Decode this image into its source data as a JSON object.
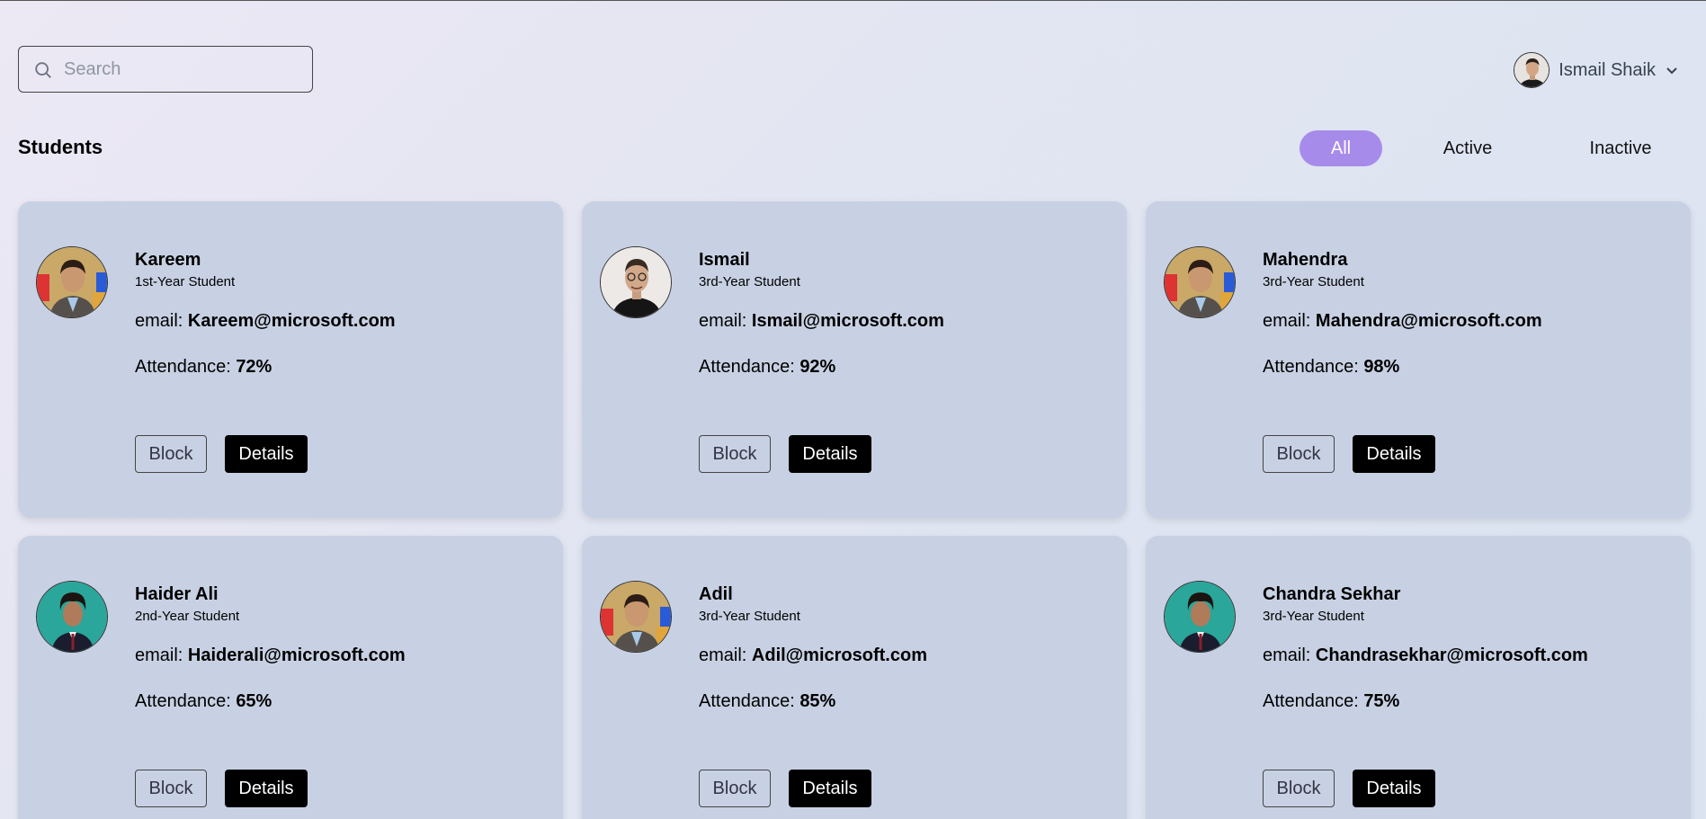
{
  "search": {
    "placeholder": "Search",
    "icon": "search-icon"
  },
  "user": {
    "name": "Ismail Shaik",
    "avatar_icon": "user-avatar",
    "menu_icon": "chevron-down-icon"
  },
  "page": {
    "title": "Students"
  },
  "filters": [
    {
      "label": "All",
      "selected": true
    },
    {
      "label": "Active",
      "selected": false
    },
    {
      "label": "Inactive",
      "selected": false
    }
  ],
  "labels": {
    "email": "email: ",
    "attendance": "Attendance: ",
    "block": "Block",
    "details": "Details"
  },
  "colors": {
    "accent": "#a78bea",
    "card": "#c8d1e3",
    "details_bg": "#000000"
  },
  "students": [
    {
      "name": "Kareem",
      "year": "1st-Year Student",
      "email": "Kareem@microsoft.com",
      "attendance": "72%",
      "photo": "suit-student-photo"
    },
    {
      "name": "Ismail",
      "year": "3rd-Year Student",
      "email": "Ismail@microsoft.com",
      "attendance": "92%",
      "photo": "glasses-man-photo"
    },
    {
      "name": "Mahendra",
      "year": "3rd-Year Student",
      "email": "Mahendra@microsoft.com",
      "attendance": "98%",
      "photo": "suit-student-photo"
    },
    {
      "name": "Haider Ali",
      "year": "2nd-Year Student",
      "email": "Haiderali@microsoft.com",
      "attendance": "65%",
      "photo": "teal-suit-man-photo"
    },
    {
      "name": "Adil",
      "year": "3rd-Year Student",
      "email": "Adil@microsoft.com",
      "attendance": "85%",
      "photo": "suit-student-photo"
    },
    {
      "name": "Chandra Sekhar",
      "year": "3rd-Year Student",
      "email": "Chandrasekhar@microsoft.com",
      "attendance": "75%",
      "photo": "teal-suit-man-photo"
    }
  ]
}
